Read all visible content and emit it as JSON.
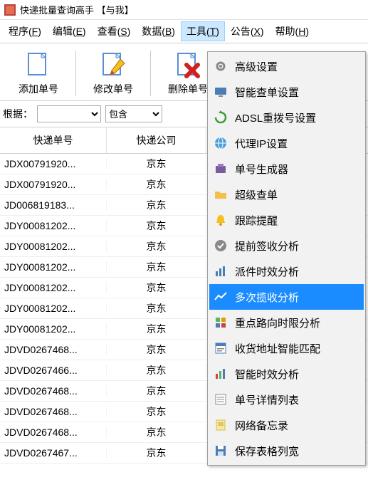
{
  "title": "快递批量查询高手 【与我】",
  "menubar": [
    {
      "label": "程序",
      "accel": "F"
    },
    {
      "label": "编辑",
      "accel": "E"
    },
    {
      "label": "查看",
      "accel": "S"
    },
    {
      "label": "数据",
      "accel": "B"
    },
    {
      "label": "工具",
      "accel": "T",
      "open": true
    },
    {
      "label": "公告",
      "accel": "X"
    },
    {
      "label": "帮助",
      "accel": "H"
    }
  ],
  "toolbar": [
    {
      "name": "add-number",
      "label": "添加单号"
    },
    {
      "name": "edit-number",
      "label": "修改单号"
    },
    {
      "name": "delete-number",
      "label": "删除单号"
    }
  ],
  "filter": {
    "label": "根据：",
    "combo1": "",
    "combo2": "包含"
  },
  "columns": [
    "快递单号",
    "快递公司"
  ],
  "rows": [
    {
      "a": "JDX00791920...",
      "b": "京东"
    },
    {
      "a": "JDX00791920...",
      "b": "京东"
    },
    {
      "a": "JD006819183...",
      "b": "京东"
    },
    {
      "a": "JDY00081202...",
      "b": "京东"
    },
    {
      "a": "JDY00081202...",
      "b": "京东"
    },
    {
      "a": "JDY00081202...",
      "b": "京东"
    },
    {
      "a": "JDY00081202...",
      "b": "京东"
    },
    {
      "a": "JDY00081202...",
      "b": "京东"
    },
    {
      "a": "JDY00081202...",
      "b": "京东"
    },
    {
      "a": "JDVD0267468...",
      "b": "京东"
    },
    {
      "a": "JDVD0267466...",
      "b": "京东"
    },
    {
      "a": "JDVD0267468...",
      "b": "京东"
    },
    {
      "a": "JDVD0267468...",
      "b": "京东"
    },
    {
      "a": "JDVD0267468...",
      "b": "京东"
    },
    {
      "a": "JDVD0267467...",
      "b": "京东"
    }
  ],
  "dropdown": [
    {
      "icon": "gear-icon",
      "label": "高级设置"
    },
    {
      "icon": "monitor-icon",
      "label": "智能查单设置"
    },
    {
      "icon": "refresh-icon",
      "label": "ADSL重拨号设置"
    },
    {
      "icon": "globe-icon",
      "label": "代理IP设置"
    },
    {
      "icon": "generator-icon",
      "label": "单号生成器"
    },
    {
      "icon": "folder-icon",
      "label": "超级查单"
    },
    {
      "icon": "bell-icon",
      "label": "跟踪提醒"
    },
    {
      "icon": "check-icon",
      "label": "提前签收分析"
    },
    {
      "icon": "chart-bar-icon",
      "label": "派件时效分析"
    },
    {
      "icon": "chart-line-icon",
      "label": "多次揽收分析",
      "hl": true
    },
    {
      "icon": "grid-icon",
      "label": "重点路向时限分析"
    },
    {
      "icon": "address-icon",
      "label": "收货地址智能匹配"
    },
    {
      "icon": "chart-color-icon",
      "label": "智能时效分析"
    },
    {
      "icon": "list-icon",
      "label": "单号详情列表"
    },
    {
      "icon": "note-icon",
      "label": "网络备忘录"
    },
    {
      "icon": "save-icon",
      "label": "保存表格列宽"
    }
  ]
}
